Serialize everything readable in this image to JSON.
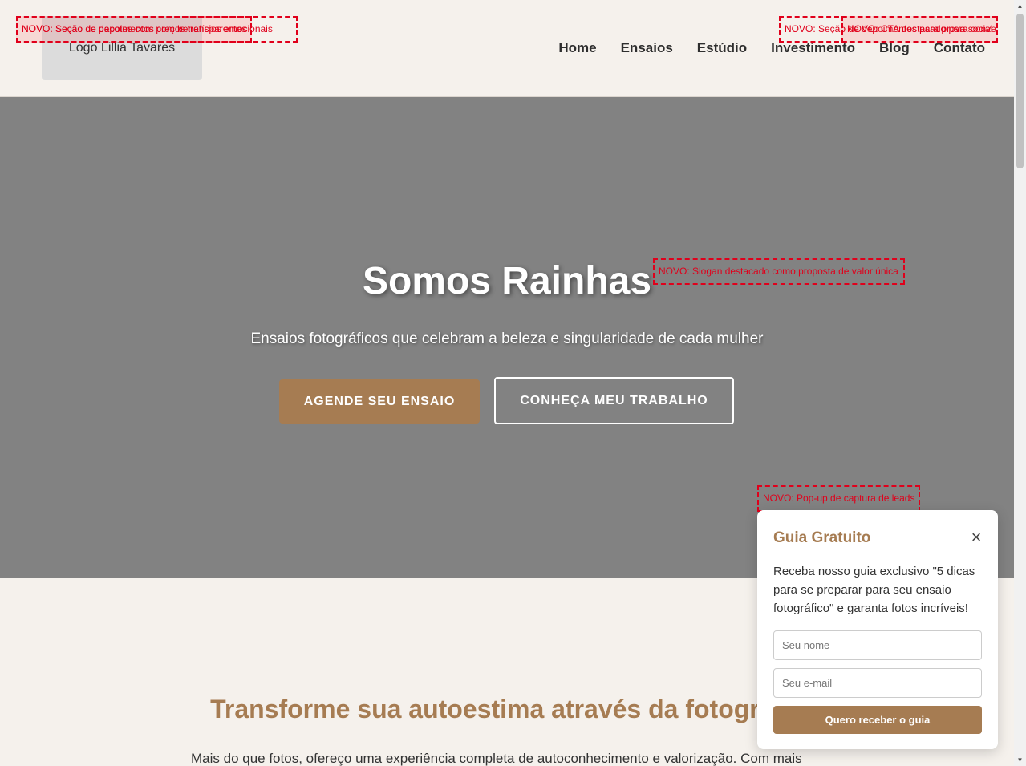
{
  "header": {
    "logo_text": "Logo Lillia Tavares",
    "nav": [
      "Home",
      "Ensaios",
      "Estúdio",
      "Investimento",
      "Blog",
      "Contato"
    ]
  },
  "annotations": {
    "left_a": "NOVO: Seção de pacotes com preços transparentes",
    "left_b": "NOVO: Seção de depoimentos com benefícios emocionais",
    "right_a": "NOVO: Seção de depoimentos para prova social",
    "right_b": "NOVO: CTA destacado para conversão",
    "slogan": "NOVO: Slogan destacado como proposta de valor única",
    "popup": "NOVO: Pop-up de captura de leads"
  },
  "hero": {
    "title": "Somos Rainhas",
    "subtitle": "Ensaios fotográficos que celebram a beleza e singularidade de cada mulher",
    "primary_cta": "AGENDE SEU ENSAIO",
    "secondary_cta": "CONHEÇA MEU TRABALHO"
  },
  "section": {
    "title": "Transforme sua autoestima através da fotografia",
    "text": "Mais do que fotos, ofereço uma experiência completa de autoconhecimento e valorização. Com mais"
  },
  "popup": {
    "title": "Guia Gratuito",
    "close": "×",
    "text": "Receba nosso guia exclusivo \"5 dicas para se preparar para seu ensaio fotográfico\" e garanta fotos incríveis!",
    "name_placeholder": "Seu nome",
    "email_placeholder": "Seu e-mail",
    "button": "Quero receber o guia"
  },
  "scrollbar": {
    "up_icon": "▲",
    "down_icon": "▼"
  },
  "colors": {
    "accent": "#a67c52",
    "background": "#f5f1ec",
    "hero_bg": "#828282",
    "annotation": "#e0001b"
  }
}
